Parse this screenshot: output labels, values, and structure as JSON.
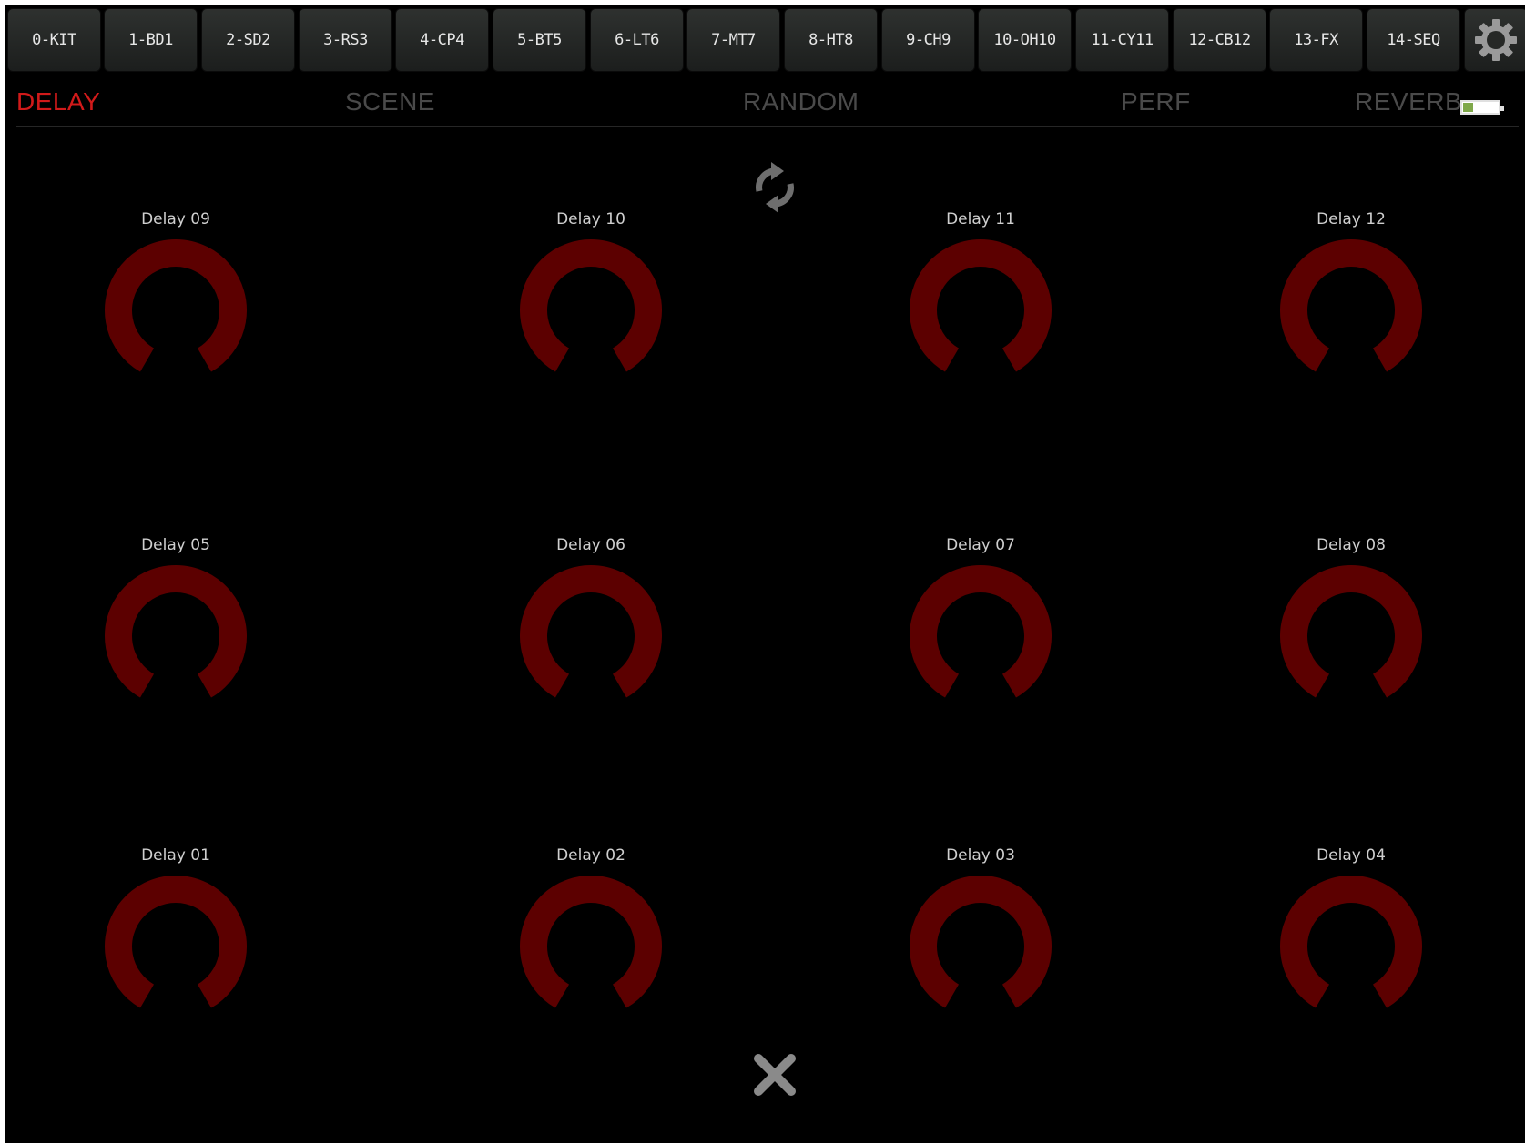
{
  "tracks": [
    {
      "label": "0-KIT"
    },
    {
      "label": "1-BD1"
    },
    {
      "label": "2-SD2"
    },
    {
      "label": "3-RS3"
    },
    {
      "label": "4-CP4"
    },
    {
      "label": "5-BT5"
    },
    {
      "label": "6-LT6"
    },
    {
      "label": "7-MT7"
    },
    {
      "label": "8-HT8"
    },
    {
      "label": "9-CH9"
    },
    {
      "label": "10-OH10"
    },
    {
      "label": "11-CY11"
    },
    {
      "label": "12-CB12"
    },
    {
      "label": "13-FX"
    },
    {
      "label": "14-SEQ"
    }
  ],
  "settings_icon": "gear-icon",
  "tabs": [
    {
      "label": "DELAY",
      "active": true
    },
    {
      "label": "SCENE",
      "active": false
    },
    {
      "label": "RANDOM",
      "active": false
    },
    {
      "label": "PERF",
      "active": false
    },
    {
      "label": "REVERB",
      "active": false
    }
  ],
  "battery": {
    "level": 0.3,
    "fill_color": "#7fa84a"
  },
  "refresh_icon": "refresh-icon",
  "close_icon": "close-icon",
  "knob_color": "#5c0000",
  "knobs": [
    {
      "label": "Delay 09"
    },
    {
      "label": "Delay 10"
    },
    {
      "label": "Delay 11"
    },
    {
      "label": "Delay 12"
    },
    {
      "label": "Delay 05"
    },
    {
      "label": "Delay 06"
    },
    {
      "label": "Delay 07"
    },
    {
      "label": "Delay 08"
    },
    {
      "label": "Delay 01"
    },
    {
      "label": "Delay 02"
    },
    {
      "label": "Delay 03"
    },
    {
      "label": "Delay 04"
    }
  ]
}
